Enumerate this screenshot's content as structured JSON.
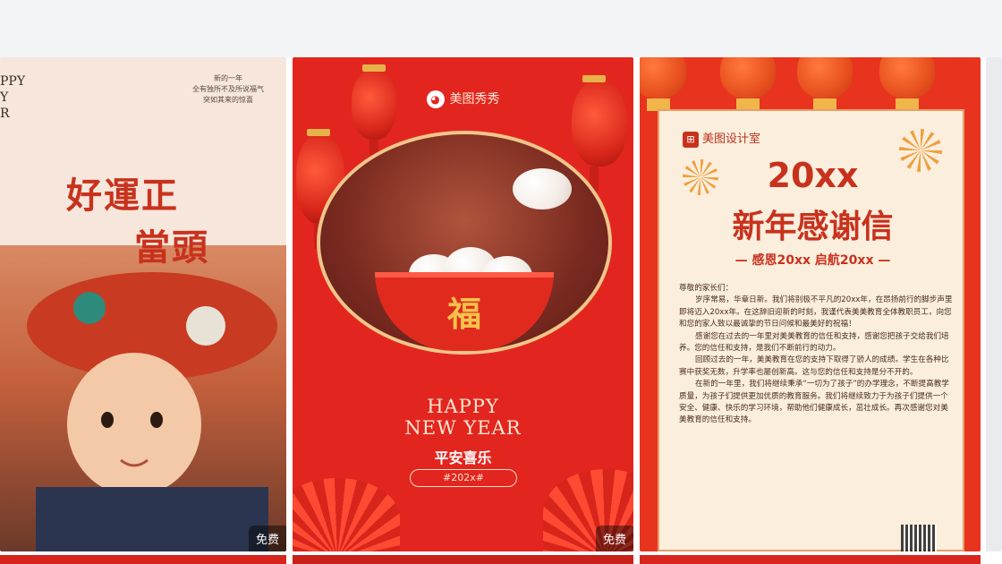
{
  "card1": {
    "top_left": [
      "PPY",
      "Y",
      "R"
    ],
    "top_right": [
      "新的一年",
      "全有独所不及所说福气",
      "突如其来的惊喜"
    ],
    "title_line1": "好運正",
    "title_line2": "當頭",
    "badge": "免费"
  },
  "card2": {
    "brand": "美图秀秀",
    "fu_char": "福",
    "happy_line1": "HAPPY",
    "happy_line2": "NEW YEAR",
    "subtitle": "平安喜乐",
    "tag": "#202x#",
    "badge": "免费"
  },
  "card3": {
    "brand": "美图设计室",
    "title1": "20xx",
    "title2": "新年感谢信",
    "subtitle": "— 感恩20xx 启航20xx —",
    "greeting": "尊敬的家长们：",
    "paragraphs": [
      "岁序常易，华章日新。我们将别极不平凡的20xx年，在昂扬前行的脚步声里即将迈入20xx年。在这辞旧迎新的时刻，我谨代表美美教育全体教职员工，向您和您的家人致以最诚挚的节日问候和最美好的祝福！",
      "感谢您在过去的一年里对美美教育的信任和支持，感谢您把孩子交给我们培养。您的信任和支持，是我们不断前行的动力。",
      "回顾过去的一年，美美教育在您的支持下取得了骄人的成绩。学生在各种比赛中获奖无数，升学率也屡创新高。这与您的信任和支持是分不开的。",
      "在新的一年里，我们将继续秉承“一切为了孩子”的办学理念，不断提高教学质量，为孩子们提供更加优质的教育服务。我们将继续致力于为孩子们提供一个安全、健康、快乐的学习环境，帮助他们健康成长，茁壮成长。再次感谢您对美美教育的信任和支持。"
    ]
  }
}
